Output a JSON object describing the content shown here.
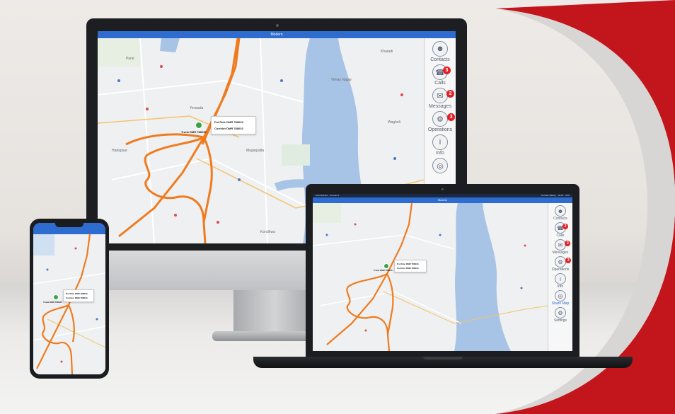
{
  "app": {
    "title": "Modern",
    "laptop_status_left": "Administrator · Account 1",
    "laptop_status_right": "Portable Battery  ·  09:53  ·  52%"
  },
  "sidebar": {
    "items": [
      {
        "label": "Contacts",
        "icon": "person-icon",
        "badge": ""
      },
      {
        "label": "Calls",
        "icon": "phone-icon",
        "badge": "3"
      },
      {
        "label": "Messages",
        "icon": "message-icon",
        "badge": "2"
      },
      {
        "label": "Operations",
        "icon": "operations-icon",
        "badge": "3"
      },
      {
        "label": "Info",
        "icon": "info-icon",
        "badge": ""
      },
      {
        "label": "Share Map",
        "icon": "globe-icon",
        "badge": ""
      },
      {
        "label": "Settings",
        "icon": "gear-icon",
        "badge": ""
      }
    ]
  },
  "map": {
    "popup_line1": "Pol Role DMR 788033",
    "popup_line2": "Corridor DMR 788033",
    "vehicle_label": "Trunk DMR 788035",
    "place_labels": [
      "Pune",
      "Kharadi",
      "Wagholi",
      "Hadapsar",
      "Magarpatta",
      "Viman Nagar",
      "Yerwada",
      "Kondhwa"
    ],
    "route_color": "#f07b1f",
    "water_color": "#a7c3e6",
    "marker_color": "#3aa348"
  },
  "brand": {
    "accent": "#c2161c",
    "titlebar_color": "#2e6ccf",
    "badge_color": "#e31f26"
  }
}
